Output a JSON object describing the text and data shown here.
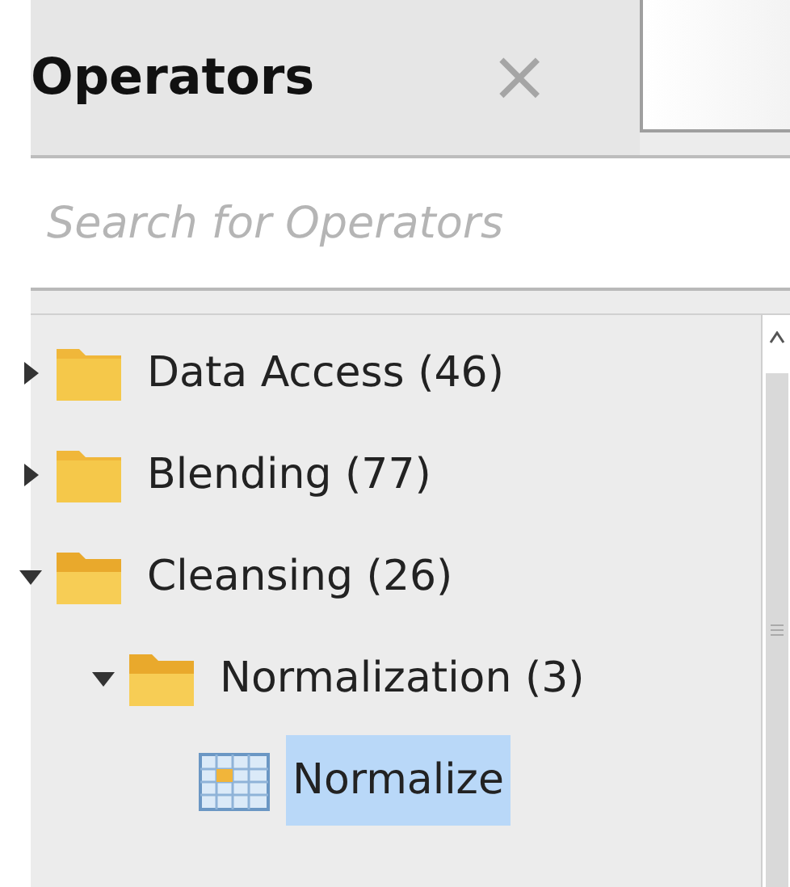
{
  "tab": {
    "label": "Operators",
    "selected": true,
    "close": "×"
  },
  "search": {
    "placeholder": "Search for Operators"
  },
  "tree": [
    {
      "label": "Data Access (46)",
      "kind": "folder",
      "expanded": false,
      "selected": false
    },
    {
      "label": "Blending (77)",
      "kind": "folder",
      "expanded": false,
      "selected": false
    },
    {
      "label": "Cleansing (26)",
      "kind": "folder",
      "expanded": true,
      "selected": false,
      "children": [
        {
          "label": "Normalization (3)",
          "kind": "folder",
          "expanded": true,
          "selected": false,
          "children": [
            {
              "label": "Normalize",
              "kind": "operator",
              "selected": true
            }
          ]
        }
      ]
    }
  ]
}
